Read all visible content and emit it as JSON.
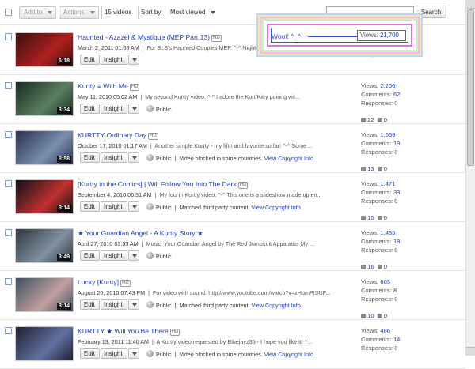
{
  "toolbar": {
    "add_to": "Add to",
    "actions": "Actions",
    "video_count": "15 videos",
    "sort_label": "Sort by:",
    "sort_value": "Most viewed",
    "search_placeholder": "",
    "search_button": "Search"
  },
  "labels": {
    "edit": "Edit",
    "insight": "Insight",
    "views": "Views:",
    "comments": "Comments:",
    "responses": "Responses:",
    "hd": "HD"
  },
  "popup": {
    "text": "Woot! ^_^",
    "views_label": "Views:",
    "views_value": "21,700"
  },
  "videos": [
    {
      "title": "Haunted - Azazel & Mystique (MEP Part 13)",
      "hd": true,
      "date": "March 2, 2011 01:05 AM",
      "description": "For BLS's Haunted Couples MEP. ^-^ Nightcrawler's parents, Aza...",
      "duration": "6:18",
      "privacy": "",
      "copyright_text": "",
      "copyright_link": "",
      "views": "21,700",
      "comments": "53",
      "responses": "0",
      "likes": "",
      "dislikes": "",
      "colors": [
        "#3a1010",
        "#b02020"
      ]
    },
    {
      "title": "Kurtty ≡ With Me",
      "hd": true,
      "date": "May 11, 2010 05:02 AM",
      "description": "My second Kurtty video. ^-^ I adore the Kurt/Kitty pairing wit...",
      "duration": "3:34",
      "privacy": "Public",
      "copyright_text": "",
      "copyright_link": "",
      "views": "2,206",
      "comments": "62",
      "responses": "0",
      "likes": "22",
      "dislikes": "0",
      "colors": [
        "#1a2a20",
        "#5a8060"
      ]
    },
    {
      "title": "KURTTY Ordinary Day",
      "hd": true,
      "date": "October 17, 2010 01:17 AM",
      "description": "Another simple Kurtty - my fifth and favorite so far! ^-^ Some ...",
      "duration": "3:58",
      "privacy": "Public",
      "copyright_text": "Video blocked in some countries.",
      "copyright_link": "View Copyright Info.",
      "views": "1,569",
      "comments": "19",
      "responses": "0",
      "likes": "13",
      "dislikes": "0",
      "colors": [
        "#2a3050",
        "#7a90b0"
      ]
    },
    {
      "title": "[Kurtty in the Comics] | Will Follow You Into The Dark",
      "hd": true,
      "date": "September 4, 2010 06:51 AM",
      "description": "My fourth Kurtty video. ^-^ This one is a slideshow made up en...",
      "duration": "3:14",
      "privacy": "Public",
      "copyright_text": "Matched third party content.",
      "copyright_link": "View Copyright Info.",
      "views": "1,471",
      "comments": "33",
      "responses": "0",
      "likes": "15",
      "dislikes": "0",
      "colors": [
        "#101018",
        "#c03030"
      ]
    },
    {
      "title": "★ Your Guardian Angel - A Kurtty Story ★",
      "hd": false,
      "date": "April 27, 2010 03:53 AM",
      "description": "Music: Your Guardian Angel by The Red Jumpsuit Apparatus My ...",
      "duration": "3:49",
      "privacy": "Public",
      "copyright_text": "",
      "copyright_link": "",
      "views": "1,435",
      "comments": "18",
      "responses": "0",
      "likes": "16",
      "dislikes": "0",
      "colors": [
        "#303840",
        "#8090a0"
      ]
    },
    {
      "title": "Lucky [Kurtty]",
      "hd": true,
      "date": "August 20, 2010 07:43 PM",
      "description": "For video with sound: http://www.youtube.com/watch?v=zHumPISUF...",
      "duration": "3:14",
      "privacy": "Public",
      "copyright_text": "Matched third party content.",
      "copyright_link": "View Copyright Info.",
      "views": "663",
      "comments": "8",
      "responses": "0",
      "likes": "10",
      "dislikes": "0",
      "colors": [
        "#405060",
        "#c0a0a0"
      ]
    },
    {
      "title": "KURTTY ★ Will You Be There",
      "hd": true,
      "date": "February 13, 2011 11:40 AM",
      "description": "A Kurtty video requested by Bluejayz35 - I hope you like it! ^...",
      "duration": "",
      "privacy": "Public",
      "copyright_text": "Video blocked in some countries.",
      "copyright_link": "View Copyright Info.",
      "views": "486",
      "comments": "14",
      "responses": "0",
      "likes": "",
      "dislikes": "",
      "colors": [
        "#202030",
        "#6070a0"
      ]
    }
  ]
}
